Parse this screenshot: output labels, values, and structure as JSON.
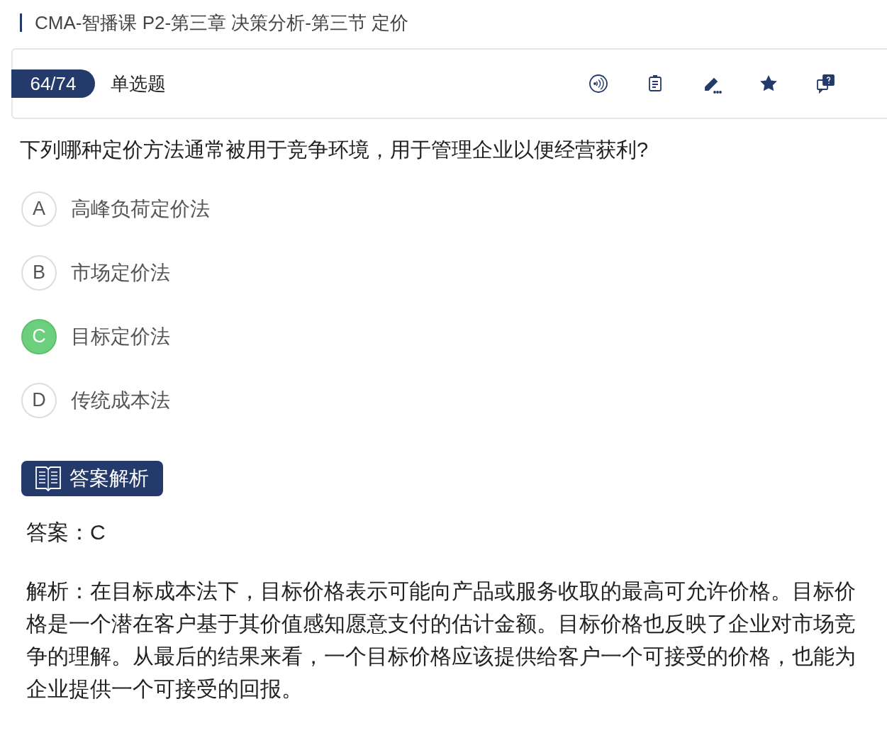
{
  "breadcrumb": "CMA-智播课 P2-第三章 决策分析-第三节 定价",
  "toolbar": {
    "progress": "64/74",
    "question_type": "单选题"
  },
  "question": "下列哪种定价方法通常被用于竞争环境，用于管理企业以便经营获利?",
  "options": [
    {
      "letter": "A",
      "text": "高峰负荷定价法",
      "selected": false
    },
    {
      "letter": "B",
      "text": "市场定价法",
      "selected": false
    },
    {
      "letter": "C",
      "text": "目标定价法",
      "selected": true
    },
    {
      "letter": "D",
      "text": "传统成本法",
      "selected": false
    }
  ],
  "analysis_button": "答案解析",
  "answer": "答案：C",
  "explanation": "解析：在目标成本法下，目标价格表示可能向产品或服务收取的最高可允许价格。目标价格是一个潜在客户基于其价值感知愿意支付的估计金额。目标价格也反映了企业对市场竞争的理解。从最后的结果来看，一个目标价格应该提供给客户一个可接受的价格，也能为企业提供一个可接受的回报。"
}
